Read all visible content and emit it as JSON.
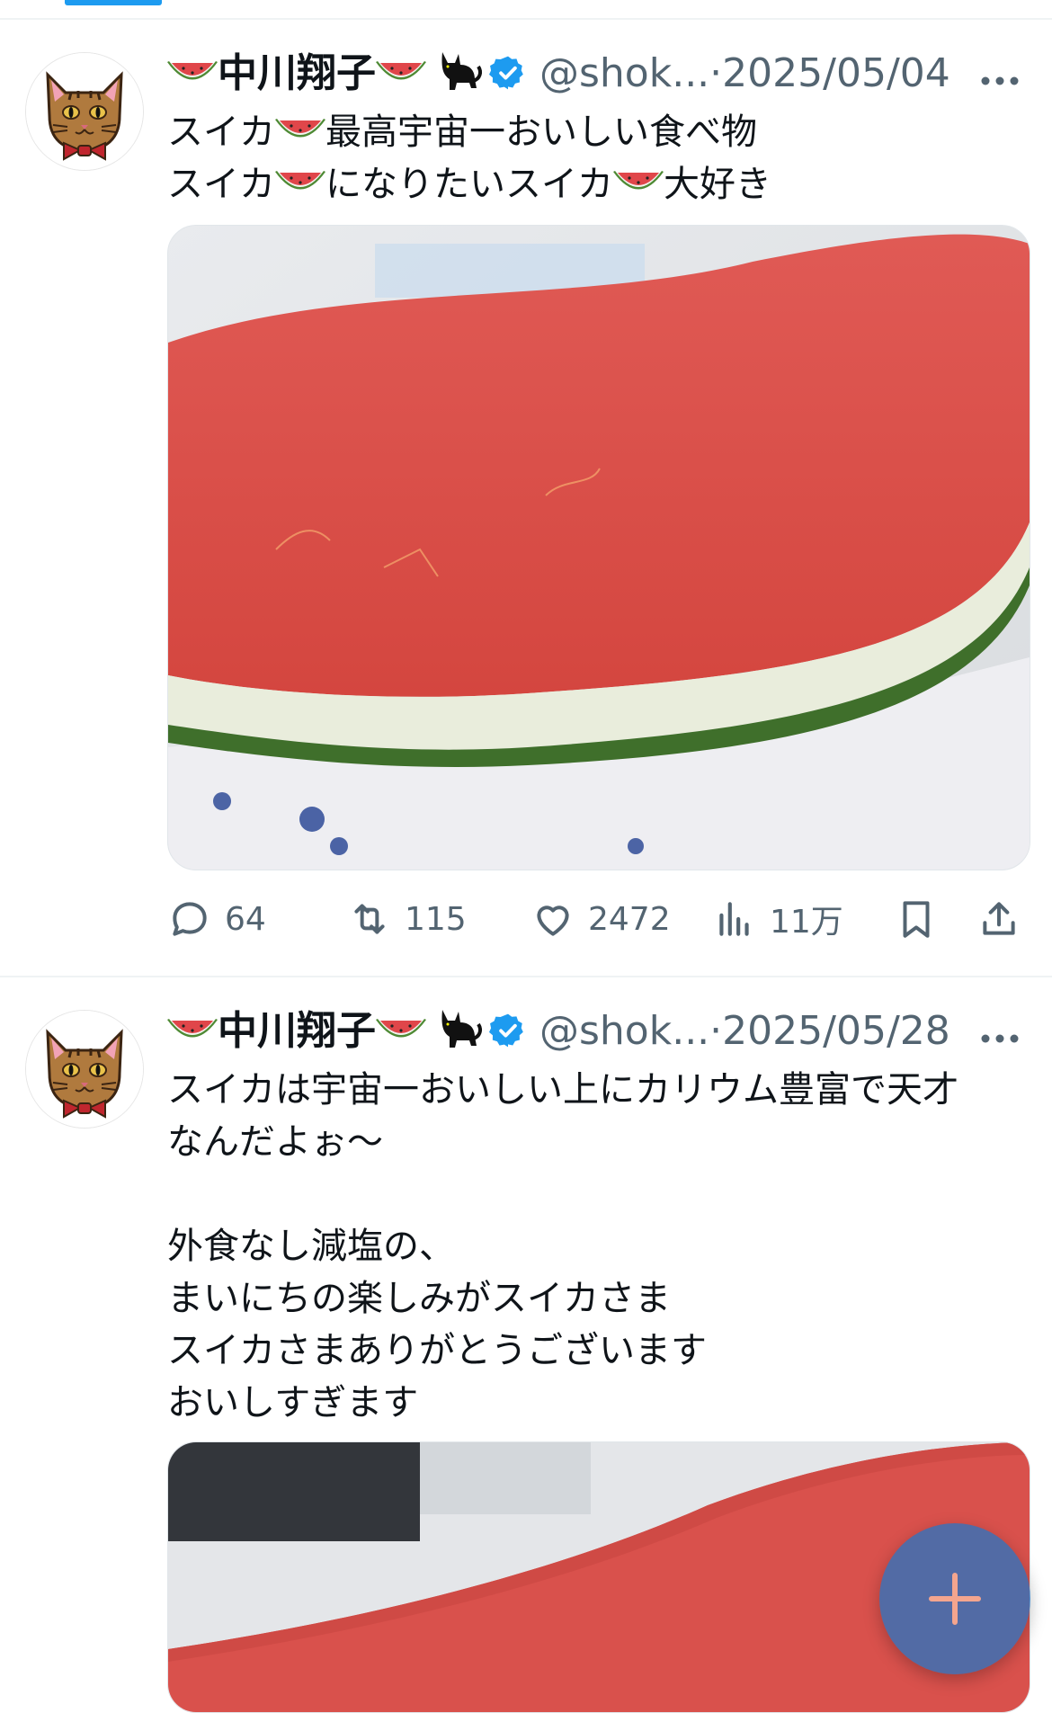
{
  "tweets": [
    {
      "name": "中川翔子",
      "handle": "@shok...",
      "separator": "·",
      "date": "2025/05/04",
      "text": {
        "l1a": "スイカ",
        "l1b": "最高宇宙一おいしい食べ物",
        "l2a": "スイカ",
        "l2b": "になりたいスイカ",
        "l2c": "大好き"
      },
      "stats": {
        "replies": "64",
        "retweets": "115",
        "likes": "2472",
        "views": "11万"
      }
    },
    {
      "name": "中川翔子",
      "handle": "@shok...",
      "separator": "·",
      "date": "2025/05/28",
      "text": {
        "l1": "スイカは宇宙一おいしい上にカリウム豊富で天才",
        "l2": "なんだよぉ〜",
        "l3": "外食なし減塩の、",
        "l4": "まいにちの楽しみがスイカさま",
        "l5": "スイカさまありがとうございます",
        "l6": "おいしすぎます"
      }
    }
  ],
  "icons": {
    "name_emoji": "watermelon-icon",
    "pet": "black-cat-icon",
    "badge": "verified-icon",
    "menu": "more-icon",
    "fab": "compose-plus-icon"
  },
  "colors": {
    "accent": "#1d9bf0",
    "text": "#0f1419",
    "muted": "#536471",
    "watermelon_flesh": "#e2504b",
    "rind": "#5f8a3c"
  }
}
